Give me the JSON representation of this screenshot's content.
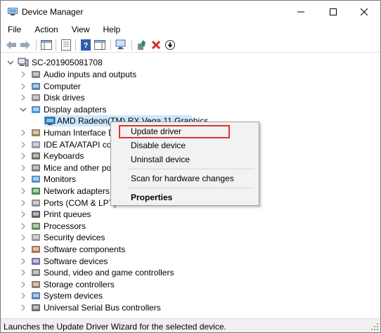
{
  "window": {
    "title": "Device Manager",
    "minimize_glyph": "—",
    "maximize_glyph": "☐",
    "close_glyph": "✕"
  },
  "menu": {
    "items": [
      "File",
      "Action",
      "View",
      "Help"
    ]
  },
  "toolbar": {
    "buttons": [
      "back-icon",
      "forward-icon",
      "show-hide-console-tree-icon",
      "properties-icon",
      "help-icon",
      "action-pane-icon",
      "scan-hardware-icon",
      "update-driver-icon",
      "uninstall-device-icon",
      "disable-device-icon"
    ]
  },
  "tree": {
    "root": "SC-201905081708",
    "categories": [
      "Audio inputs and outputs",
      "Computer",
      "Disk drives",
      "Display adapters",
      "Human Interface D",
      "IDE ATA/ATAPI con",
      "Keyboards",
      "Mice and other poi",
      "Monitors",
      "Network adapters",
      "Ports (COM & LPT)",
      "Print queues",
      "Processors",
      "Security devices",
      "Software components",
      "Software devices",
      "Sound, video and game controllers",
      "Storage controllers",
      "System devices",
      "Universal Serial Bus controllers"
    ],
    "expanded_category": "Display adapters",
    "selected_device": "AMD Radeon(TM) RX Vega 11 Graphics"
  },
  "context_menu": {
    "items": {
      "update_driver": "Update driver",
      "disable_device": "Disable device",
      "uninstall_device": "Uninstall device",
      "scan": "Scan for hardware changes",
      "properties": "Properties"
    },
    "highlighted": "Update driver",
    "highlight_color": "#e0332f"
  },
  "status": {
    "text": "Launches the Update Driver Wizard for the selected device."
  },
  "colors": {
    "selection": "#cce8ff",
    "menu_bg": "#f2f2f2",
    "status_bg": "#f0f0f0"
  }
}
